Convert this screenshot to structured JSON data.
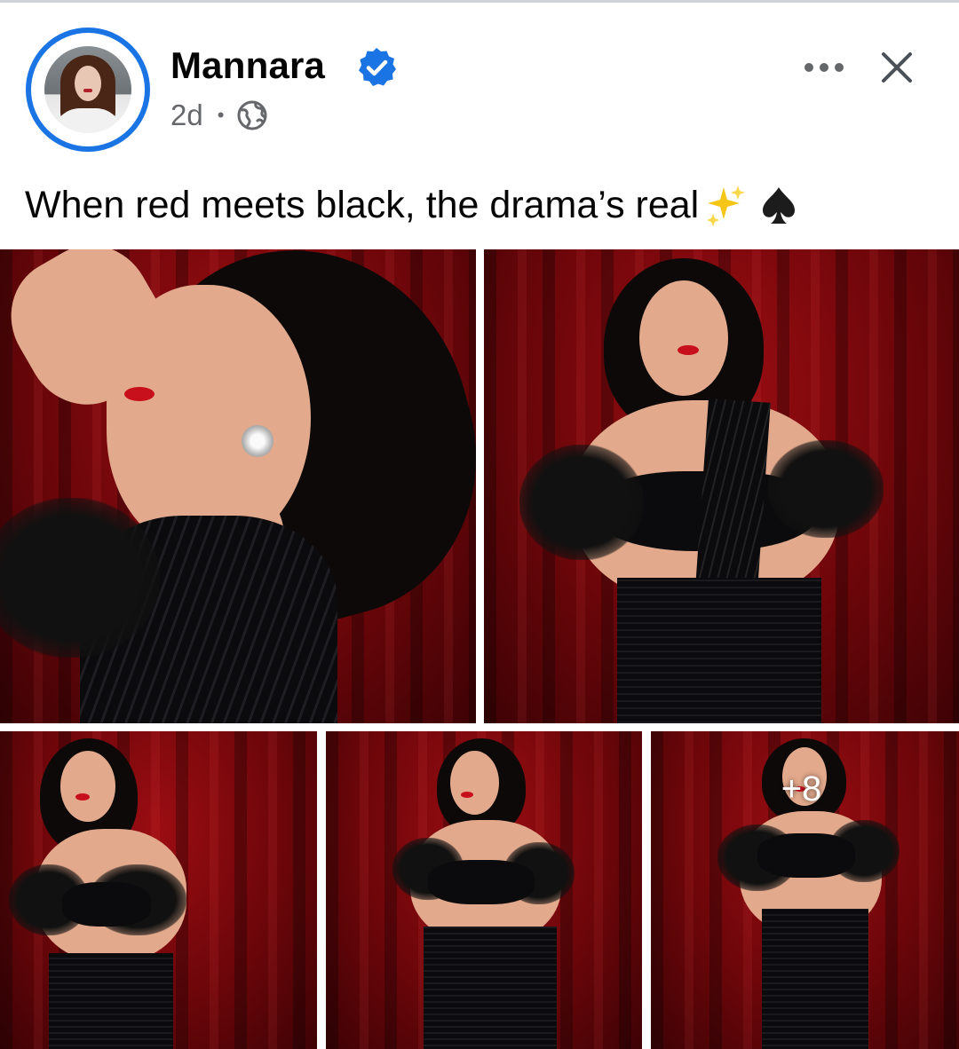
{
  "post": {
    "author": "Mannara",
    "timestamp": "2d",
    "separator": "•",
    "audience_icon": "globe-icon",
    "verified_icon": "verified-badge-icon",
    "caption": "When red meets black, the drama’s real",
    "caption_emojis": [
      "sparkles-emoji",
      "spade-suit-emoji"
    ]
  },
  "actions": {
    "more_icon": "more-horizontal-icon",
    "close_icon": "close-icon"
  },
  "gallery": {
    "photo_count_visible": 5,
    "more_overlay": "+8"
  },
  "colors": {
    "accent": "#1b74e4",
    "text_primary": "#050505",
    "text_secondary": "#65676b",
    "backdrop_red": "#8a0a10"
  }
}
